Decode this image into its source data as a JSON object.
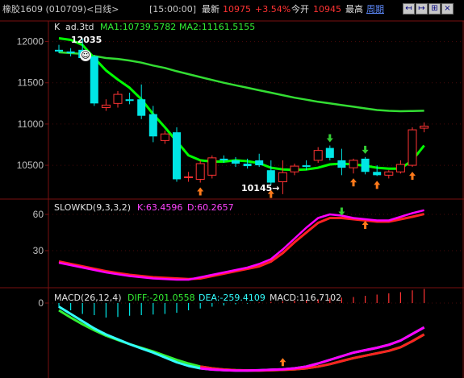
{
  "header": {
    "title": "橡胶1609 (010709)<日线>",
    "time": "[15:00:00]",
    "latest_label": "最新",
    "latest_value": "10975",
    "change_pct": "+3.54%",
    "open_label": "今开",
    "open_value": "10945",
    "high_label": "最高",
    "period_link": "周期"
  },
  "nav_buttons": [
    {
      "name": "prev-record-button",
      "label": "↤"
    },
    {
      "name": "next-record-button",
      "label": "↦"
    },
    {
      "name": "zoom-button",
      "label": "⊞"
    },
    {
      "name": "close-button",
      "label": "×"
    }
  ],
  "main_panel": {
    "label": "K",
    "formula": "ad.3td",
    "ma1": "MA1:10739.5782",
    "ma2": "MA2:11161.5155",
    "high_annotation": "12035",
    "low_annotation": "10145→"
  },
  "kd_panel": {
    "label": "SLOWKD(9,3,3,2)",
    "k": "K:63.4596",
    "d": "D:60.2657"
  },
  "macd_panel": {
    "label": "MACD(26,12,4)",
    "diff": "DIFF:-201.0558",
    "dea": "DEA:-259.4109",
    "macd": "MACD:116.7102"
  },
  "colors": {
    "background": "#000000",
    "grid": "#7a1010",
    "axis_text": "#c0c0c0",
    "up": "#ff3333",
    "down": "#00e5e5",
    "ma1": "#00ff00",
    "ma2": "#33dd33",
    "k_line": "#ff00ff",
    "d_line": "#ff2222",
    "diff_line": "#33ffff",
    "dea_line": "#33ee33"
  },
  "chart_data": [
    {
      "type": "candlestick",
      "title": "K ad.3td",
      "y_ticks": [
        12000,
        11500,
        11000,
        10500
      ],
      "ylim": [
        10100,
        12250
      ],
      "annotations": [
        "12035",
        "10145→"
      ],
      "candles": [
        {
          "o": 11900,
          "h": 11960,
          "l": 11860,
          "c": 11880
        },
        {
          "o": 11880,
          "h": 11920,
          "l": 11820,
          "c": 11860
        },
        {
          "o": 11900,
          "h": 12035,
          "l": 11790,
          "c": 11800
        },
        {
          "o": 11820,
          "h": 11840,
          "l": 11220,
          "c": 11250
        },
        {
          "o": 11200,
          "h": 11300,
          "l": 11160,
          "c": 11230
        },
        {
          "o": 11250,
          "h": 11400,
          "l": 11200,
          "c": 11360
        },
        {
          "o": 11300,
          "h": 11380,
          "l": 11240,
          "c": 11280
        },
        {
          "o": 11300,
          "h": 11480,
          "l": 11060,
          "c": 11100
        },
        {
          "o": 11120,
          "h": 11220,
          "l": 10780,
          "c": 10850
        },
        {
          "o": 10800,
          "h": 10920,
          "l": 10760,
          "c": 10880
        },
        {
          "o": 10900,
          "h": 10960,
          "l": 10300,
          "c": 10330
        },
        {
          "o": 10350,
          "h": 10420,
          "l": 10300,
          "c": 10360
        },
        {
          "o": 10330,
          "h": 10560,
          "l": 10290,
          "c": 10520
        },
        {
          "o": 10380,
          "h": 10620,
          "l": 10340,
          "c": 10590
        },
        {
          "o": 10580,
          "h": 10620,
          "l": 10530,
          "c": 10560
        },
        {
          "o": 10560,
          "h": 10600,
          "l": 10480,
          "c": 10520
        },
        {
          "o": 10520,
          "h": 10580,
          "l": 10460,
          "c": 10490
        },
        {
          "o": 10560,
          "h": 10640,
          "l": 10480,
          "c": 10500
        },
        {
          "o": 10440,
          "h": 10560,
          "l": 10260,
          "c": 10290
        },
        {
          "o": 10300,
          "h": 10560,
          "l": 10150,
          "c": 10410
        },
        {
          "o": 10420,
          "h": 10520,
          "l": 10380,
          "c": 10490
        },
        {
          "o": 10500,
          "h": 10560,
          "l": 10440,
          "c": 10480
        },
        {
          "o": 10560,
          "h": 10720,
          "l": 10530,
          "c": 10680
        },
        {
          "o": 10710,
          "h": 10740,
          "l": 10560,
          "c": 10590
        },
        {
          "o": 10560,
          "h": 10700,
          "l": 10380,
          "c": 10470
        },
        {
          "o": 10470,
          "h": 10580,
          "l": 10400,
          "c": 10560
        },
        {
          "o": 10580,
          "h": 10600,
          "l": 10390,
          "c": 10420
        },
        {
          "o": 10420,
          "h": 10500,
          "l": 10370,
          "c": 10380
        },
        {
          "o": 10380,
          "h": 10440,
          "l": 10340,
          "c": 10420
        },
        {
          "o": 10420,
          "h": 10560,
          "l": 10400,
          "c": 10510
        },
        {
          "o": 10500,
          "h": 10960,
          "l": 10480,
          "c": 10930
        },
        {
          "o": 10950,
          "h": 11020,
          "l": 10900,
          "c": 10975
        }
      ],
      "series": [
        {
          "name": "MA1",
          "values": [
            12040,
            12020,
            11960,
            11800,
            11650,
            11540,
            11440,
            11300,
            11120,
            10960,
            10790,
            10620,
            10560,
            10545,
            10545,
            10560,
            10550,
            10525,
            10470,
            10450,
            10445,
            10450,
            10470,
            10510,
            10520,
            10510,
            10495,
            10470,
            10460,
            10460,
            10560,
            10739
          ]
        },
        {
          "name": "MA2",
          "values": [
            11870,
            11860,
            11850,
            11825,
            11800,
            11790,
            11770,
            11745,
            11710,
            11680,
            11640,
            11605,
            11570,
            11535,
            11500,
            11470,
            11440,
            11410,
            11380,
            11350,
            11320,
            11295,
            11270,
            11250,
            11230,
            11210,
            11190,
            11170,
            11160,
            11155,
            11158,
            11161
          ]
        }
      ],
      "signal_markers": [
        {
          "index": 12,
          "dir": "up"
        },
        {
          "index": 18,
          "dir": "up"
        },
        {
          "index": 23,
          "dir": "down"
        },
        {
          "index": 25,
          "dir": "up"
        },
        {
          "index": 26,
          "dir": "down"
        },
        {
          "index": 27,
          "dir": "up"
        },
        {
          "index": 30,
          "dir": "up"
        }
      ]
    },
    {
      "type": "line",
      "title": "SLOWKD(9,3,3,2)",
      "y_ticks": [
        60,
        30
      ],
      "ylim": [
        0,
        72
      ],
      "series": [
        {
          "name": "K",
          "values": [
            20,
            18,
            16,
            14,
            12,
            10.5,
            9,
            8,
            7,
            6.5,
            6,
            6,
            8,
            10,
            12,
            14,
            16,
            19,
            23,
            31,
            40,
            49,
            57,
            60,
            59,
            57,
            56,
            55,
            55,
            58,
            61,
            63.46
          ]
        },
        {
          "name": "D",
          "values": [
            21,
            19,
            17,
            15,
            13,
            11.5,
            10,
            9,
            8,
            7.5,
            7,
            6.5,
            7,
            9,
            11,
            13,
            15,
            17,
            21,
            28,
            37,
            45,
            53,
            57,
            57,
            56,
            55,
            54,
            54,
            56,
            58,
            60.27
          ]
        }
      ],
      "signal_markers": [
        {
          "index": 24,
          "dir": "down"
        },
        {
          "index": 26,
          "dir": "up"
        }
      ]
    },
    {
      "type": "bar+line",
      "title": "MACD(26,12,4)",
      "y_ticks": [
        0
      ],
      "ylim": [
        -620,
        120
      ],
      "macd_bars": [
        -40,
        -60,
        -90,
        -100,
        -120,
        -115,
        -105,
        -100,
        -95,
        -90,
        -80,
        -60,
        -45,
        -30,
        -20,
        -10,
        -5,
        5,
        10,
        15,
        20,
        25,
        30,
        40,
        45,
        50,
        60,
        70,
        80,
        90,
        105,
        116.71
      ],
      "series": [
        {
          "name": "DIFF",
          "values": [
            -30,
            -90,
            -150,
            -210,
            -260,
            -300,
            -340,
            -375,
            -410,
            -450,
            -490,
            -520,
            -540,
            -550,
            -555,
            -558,
            -558,
            -556,
            -552,
            -548,
            -540,
            -525,
            -500,
            -470,
            -440,
            -410,
            -390,
            -370,
            -345,
            -310,
            -255,
            -201.06
          ]
        },
        {
          "name": "DEA",
          "values": [
            -60,
            -120,
            -175,
            -225,
            -270,
            -305,
            -340,
            -370,
            -400,
            -435,
            -470,
            -500,
            -525,
            -540,
            -550,
            -555,
            -557,
            -558,
            -556,
            -553,
            -548,
            -540,
            -525,
            -505,
            -480,
            -455,
            -435,
            -415,
            -395,
            -365,
            -315,
            -259.41
          ]
        }
      ],
      "signal_markers": [
        {
          "index": 19,
          "dir": "up"
        }
      ]
    }
  ]
}
